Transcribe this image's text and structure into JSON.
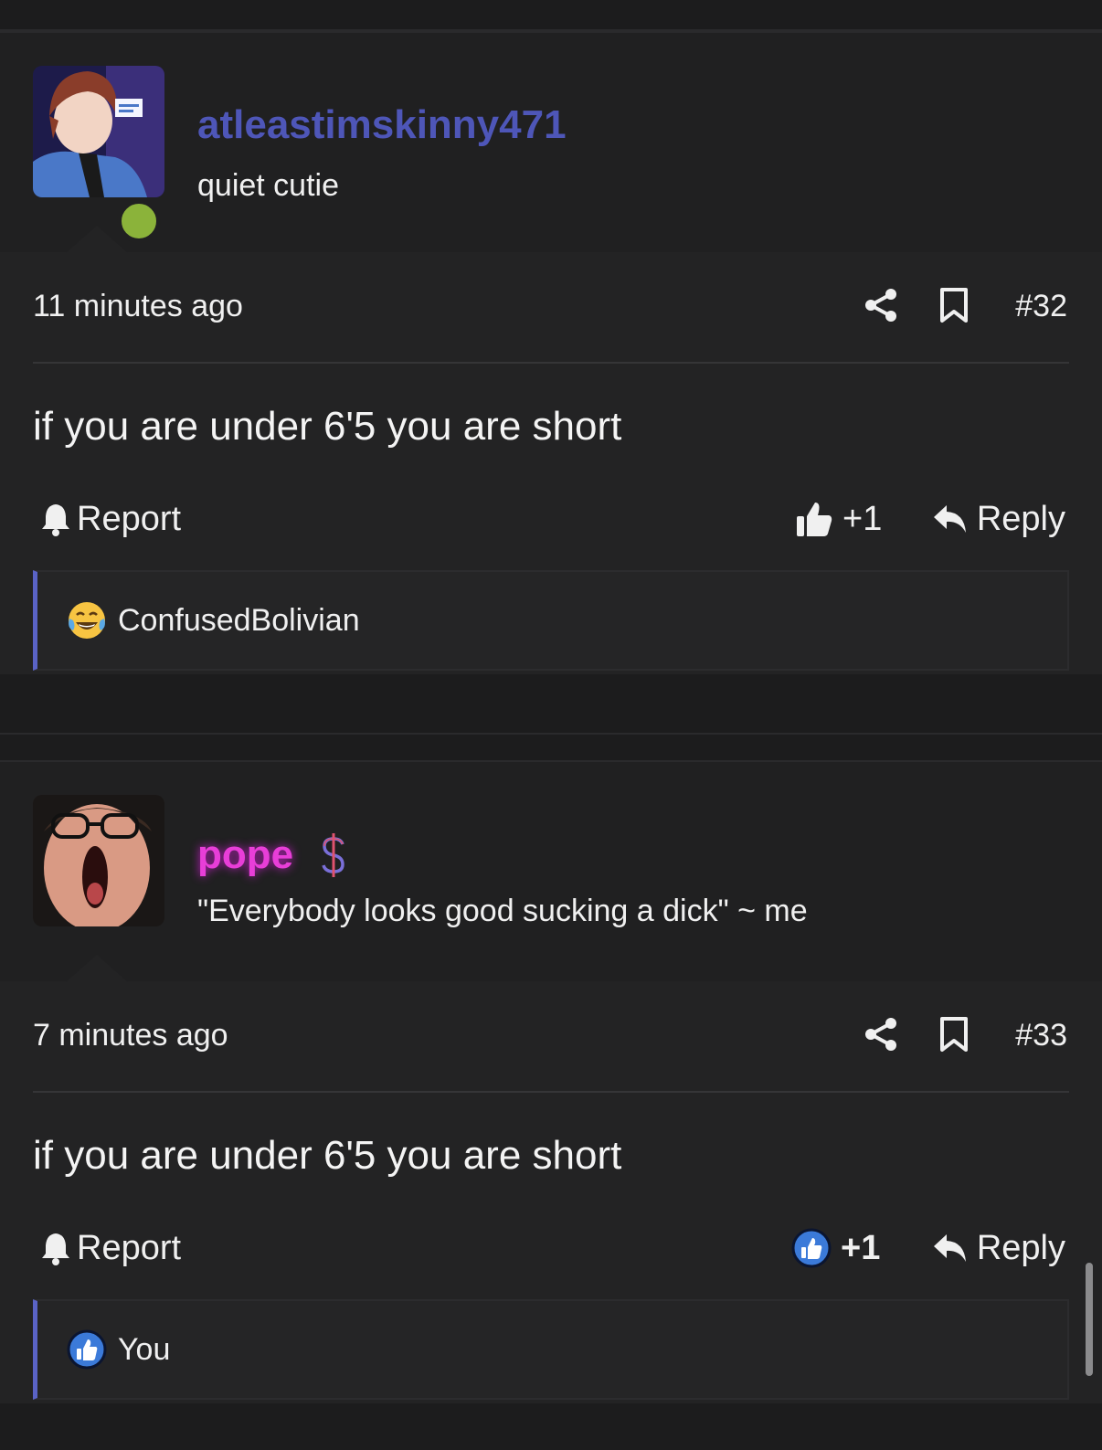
{
  "posts": [
    {
      "username": "atleastimskinny471",
      "username_color": "#4e56b8",
      "user_title": "quiet cutie",
      "online": true,
      "timestamp": "11 minutes ago",
      "post_number": "#32",
      "content": "if you are under 6'5 you are short",
      "report_label": "Report",
      "like_count": "+1",
      "reply_label": "Reply",
      "reaction_user": "ConfusedBolivian",
      "reaction_icon": "laughing-crying-icon"
    },
    {
      "username": "pope",
      "username_color": "#e83ed8",
      "user_title": "\"Everybody looks good sucking a dick\" ~ me",
      "badge_icon": "dollar-icon",
      "timestamp": "7 minutes ago",
      "post_number": "#33",
      "content": "if you are under 6'5 you are short",
      "report_label": "Report",
      "like_count": "+1",
      "liked_by_me": true,
      "reply_label": "Reply",
      "reaction_user": "You",
      "reaction_icon": "like-icon"
    }
  ],
  "colors": {
    "accent": "#5a63c6",
    "online": "#8bb33a",
    "like_blue": "#3b7ad9"
  }
}
